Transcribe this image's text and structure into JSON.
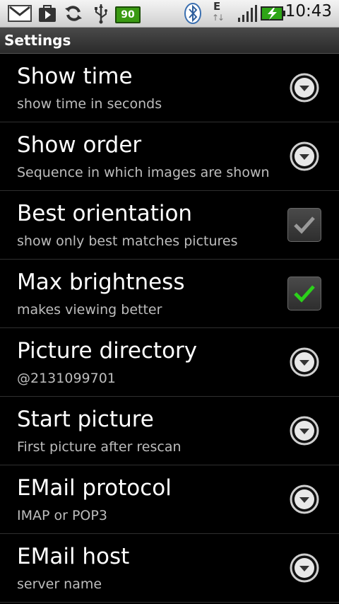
{
  "status_bar": {
    "battery_level": "90",
    "time": "10:43",
    "network_type": "E",
    "icons": [
      "gmail-icon",
      "play-store-icon",
      "sync-icon",
      "usb-icon",
      "battery-small-icon",
      "bluetooth-icon",
      "network-e-icon",
      "signal-icon",
      "battery-charging-icon"
    ]
  },
  "title": "Settings",
  "items": [
    {
      "title": "Show time",
      "summary": "show time in seconds",
      "widget": "dropdown"
    },
    {
      "title": "Show order",
      "summary": "Sequence in which images are shown",
      "widget": "dropdown"
    },
    {
      "title": "Best orientation",
      "summary": "show only best matches pictures",
      "widget": "checkbox",
      "checked": false
    },
    {
      "title": "Max brightness",
      "summary": "makes viewing better",
      "widget": "checkbox",
      "checked": true
    },
    {
      "title": "Picture directory",
      "summary": "@2131099701",
      "widget": "dropdown"
    },
    {
      "title": "Start picture",
      "summary": "First picture after rescan",
      "widget": "dropdown"
    },
    {
      "title": "EMail protocol",
      "summary": "IMAP or POP3",
      "widget": "dropdown"
    },
    {
      "title": "EMail host",
      "summary": "server name",
      "widget": "dropdown"
    }
  ],
  "colors": {
    "check_on": "#2bd11a",
    "check_off": "#9a9a9a",
    "background": "#000000"
  }
}
